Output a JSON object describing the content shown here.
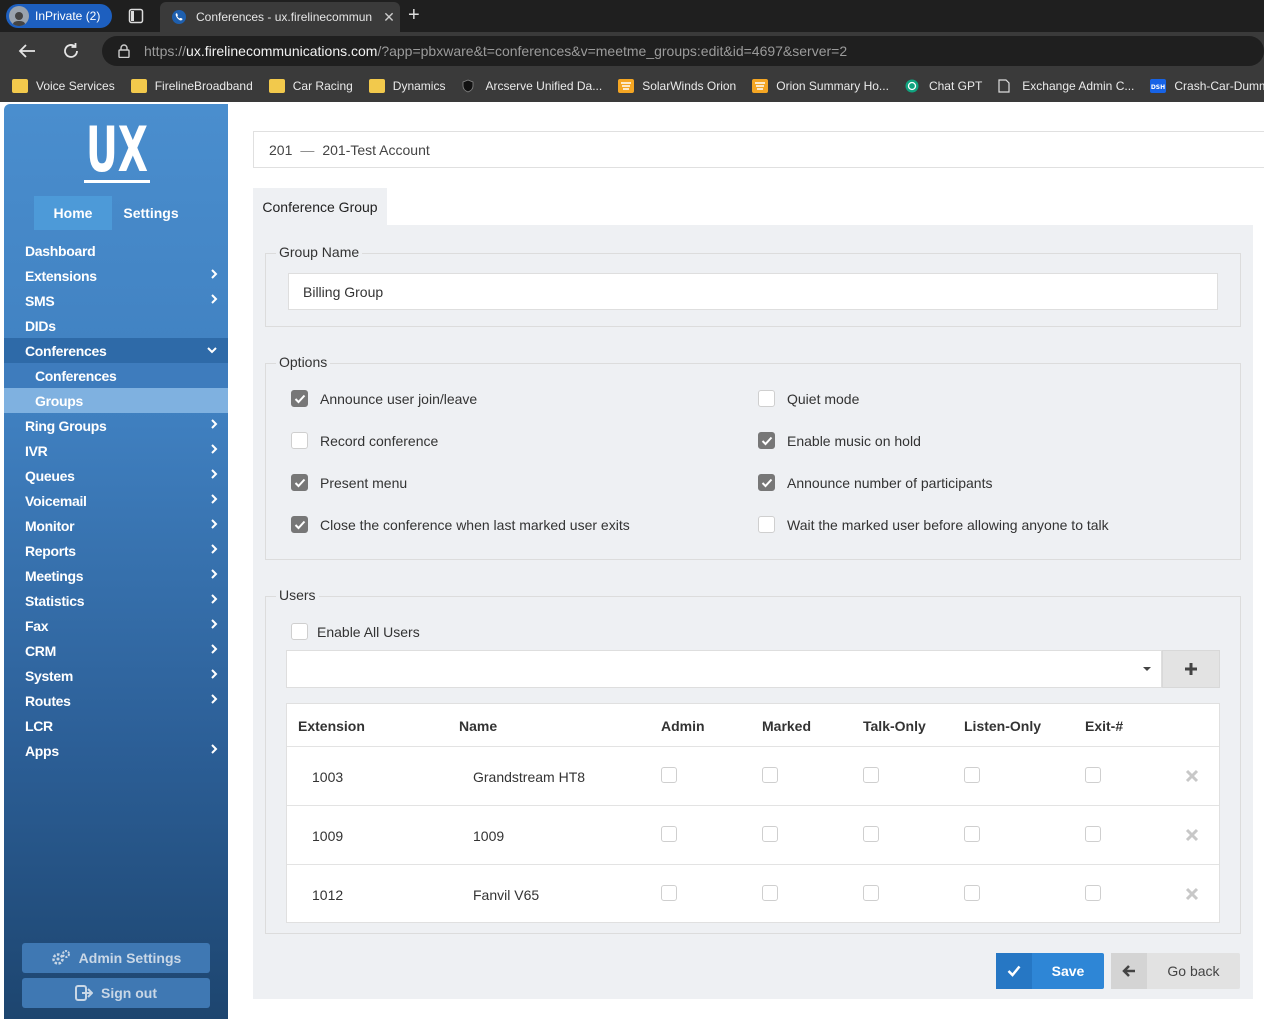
{
  "browser": {
    "inprivate_label": "InPrivate (2)",
    "tab_title": "Conferences - ux.firelinecommun",
    "url_prefix": "https://",
    "url_host": "ux.firelinecommunications.com",
    "url_rest": "/?app=pbxware&t=conferences&v=meetme_groups:edit&id=4697&server=2",
    "bookmarks": [
      {
        "label": "Voice Services",
        "icon": "folder"
      },
      {
        "label": "FirelineBroadband",
        "icon": "folder"
      },
      {
        "label": "Car Racing",
        "icon": "folder"
      },
      {
        "label": "Dynamics",
        "icon": "folder"
      },
      {
        "label": "Arcserve Unified Da...",
        "icon": "shield"
      },
      {
        "label": "SolarWinds Orion",
        "icon": "orion"
      },
      {
        "label": "Orion Summary Ho...",
        "icon": "orion"
      },
      {
        "label": "Chat GPT",
        "icon": "chatgpt"
      },
      {
        "label": "Exchange Admin C...",
        "icon": "page"
      },
      {
        "label": "Crash-Car-Dummies",
        "icon": "dsh"
      }
    ]
  },
  "sidebar": {
    "logo_text": "UX",
    "tabs": {
      "home": "Home",
      "settings": "Settings"
    },
    "menu": [
      {
        "label": "Dashboard",
        "arrow": false
      },
      {
        "label": "Extensions",
        "arrow": true
      },
      {
        "label": "SMS",
        "arrow": true
      },
      {
        "label": "DIDs",
        "arrow": false
      },
      {
        "label": "Conferences",
        "arrow": "down"
      },
      {
        "label": "Conferences",
        "sub": true
      },
      {
        "label": "Groups",
        "sub": true
      },
      {
        "label": "Ring Groups",
        "arrow": true
      },
      {
        "label": "IVR",
        "arrow": true
      },
      {
        "label": "Queues",
        "arrow": true
      },
      {
        "label": "Voicemail",
        "arrow": true
      },
      {
        "label": "Monitor",
        "arrow": true
      },
      {
        "label": "Reports",
        "arrow": true
      },
      {
        "label": "Meetings",
        "arrow": true
      },
      {
        "label": "Statistics",
        "arrow": true
      },
      {
        "label": "Fax",
        "arrow": true
      },
      {
        "label": "CRM",
        "arrow": true
      },
      {
        "label": "System",
        "arrow": true
      },
      {
        "label": "Routes",
        "arrow": true
      },
      {
        "label": "LCR",
        "arrow": false
      },
      {
        "label": "Apps",
        "arrow": true
      }
    ],
    "admin_settings": "Admin Settings",
    "sign_out": "Sign out"
  },
  "account": {
    "number": "201",
    "separator": "—",
    "name": "201-Test Account"
  },
  "form": {
    "tab_label": "Conference Group",
    "group_name_legend": "Group Name",
    "group_name_value": "Billing Group",
    "options_legend": "Options",
    "options": {
      "announce_join": {
        "label": "Announce user join/leave",
        "checked": true
      },
      "record": {
        "label": "Record conference",
        "checked": false
      },
      "present_menu": {
        "label": "Present menu",
        "checked": true
      },
      "close_last_marked": {
        "label": "Close the conference when last marked user exits",
        "checked": true
      },
      "quiet_mode": {
        "label": "Quiet mode",
        "checked": false
      },
      "music_on_hold": {
        "label": "Enable music on hold",
        "checked": true
      },
      "announce_count": {
        "label": "Announce number of participants",
        "checked": true
      },
      "wait_marked": {
        "label": "Wait the marked user before allowing anyone to talk",
        "checked": false
      }
    },
    "users_legend": "Users",
    "enable_all_users": "Enable All Users",
    "table": {
      "headers": [
        "Extension",
        "Name",
        "Admin",
        "Marked",
        "Talk-Only",
        "Listen-Only",
        "Exit-#"
      ],
      "rows": [
        {
          "extension": "1003",
          "name": "Grandstream HT8"
        },
        {
          "extension": "1009",
          "name": "1009"
        },
        {
          "extension": "1012",
          "name": "Fanvil V65"
        }
      ]
    },
    "save_label": "Save",
    "back_label": "Go back"
  }
}
